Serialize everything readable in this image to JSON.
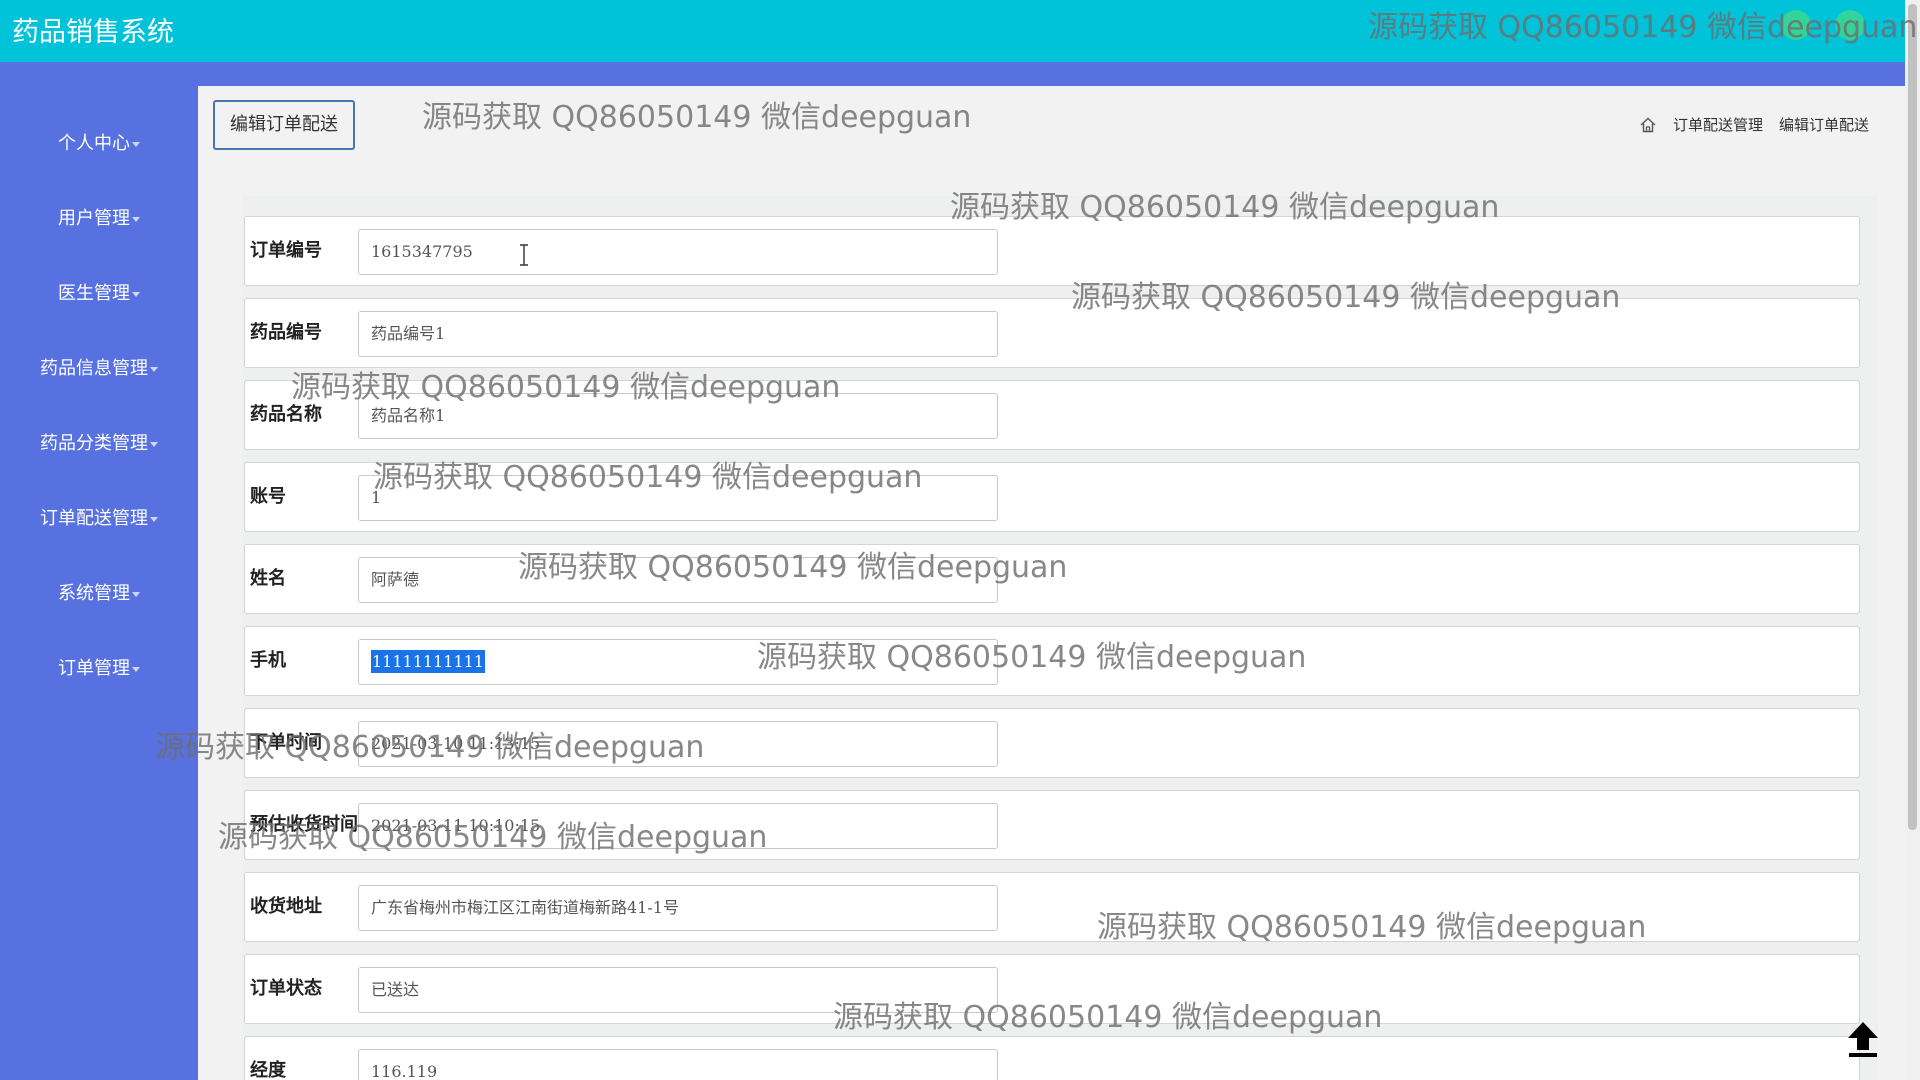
{
  "app": {
    "title": "药品销售系统"
  },
  "sidebar": {
    "items": [
      {
        "label": "个人中心"
      },
      {
        "label": "用户管理"
      },
      {
        "label": "医生管理"
      },
      {
        "label": "药品信息管理"
      },
      {
        "label": "药品分类管理"
      },
      {
        "label": "订单配送管理"
      },
      {
        "label": "系统管理"
      },
      {
        "label": "订单管理"
      }
    ]
  },
  "page": {
    "title_button": "编辑订单配送",
    "breadcrumb": {
      "level1": "订单配送管理",
      "level2": "编辑订单配送"
    }
  },
  "form": {
    "fields": [
      {
        "label": "订单编号",
        "value": "1615347795"
      },
      {
        "label": "药品编号",
        "value": "药品编号1"
      },
      {
        "label": "药品名称",
        "value": "药品名称1"
      },
      {
        "label": "账号",
        "value": "1"
      },
      {
        "label": "姓名",
        "value": "阿萨德"
      },
      {
        "label": "手机",
        "value": "11111111111"
      },
      {
        "label": "下单时间",
        "value": "2021-03-10 11:13:15"
      },
      {
        "label": "预估收货时间",
        "value": "2021-03-11 10:10:15"
      },
      {
        "label": "收货地址",
        "value": "广东省梅州市梅江区江南街道梅新路41-1号"
      },
      {
        "label": "订单状态",
        "value": "已送达"
      },
      {
        "label": "经度",
        "value": "116.119"
      }
    ]
  },
  "watermark": {
    "text": "源码获取 QQ86050149 微信deepguan"
  },
  "icons": {
    "home": "home-icon",
    "back_to_top": "up-arrow-icon",
    "text_cursor": "text-cursor-icon"
  },
  "colors": {
    "topbar": "#00c2d9",
    "sidebar": "#5871e0",
    "selection": "#1a73e8"
  }
}
